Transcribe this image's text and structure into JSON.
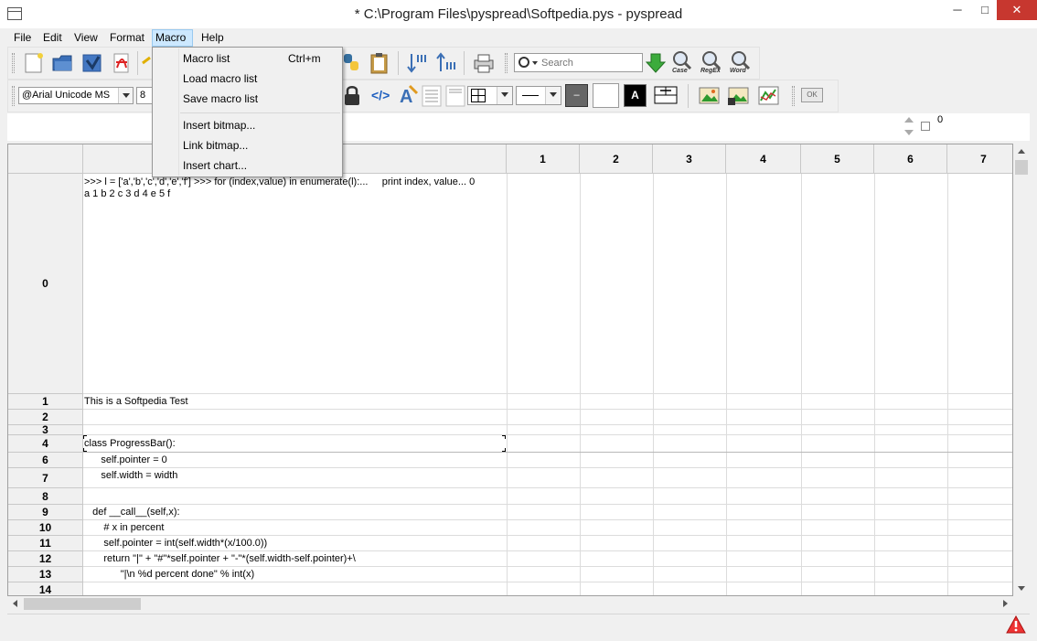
{
  "window": {
    "title": "* C:\\Program Files\\pyspread\\Softpedia.pys - pyspread",
    "min_glyph": "─",
    "max_glyph": "□",
    "close_glyph": "✕"
  },
  "menubar": {
    "items": [
      "File",
      "Edit",
      "View",
      "Format",
      "Macro",
      "Help"
    ],
    "active": "Macro"
  },
  "macro_menu": {
    "items": [
      {
        "label": "Macro list",
        "shortcut": "Ctrl+m"
      },
      {
        "label": "Load macro list",
        "shortcut": ""
      },
      {
        "label": "Save macro list",
        "shortcut": ""
      },
      {
        "label": "Insert bitmap...",
        "shortcut": ""
      },
      {
        "label": "Link bitmap...",
        "shortcut": ""
      },
      {
        "label": "Insert chart...",
        "shortcut": ""
      }
    ]
  },
  "toolbar": {
    "search_placeholder": "Search",
    "search_option_labels": [
      "Case",
      "RegEx",
      "Word"
    ],
    "ok_label": "OK",
    "table_number_label": "0"
  },
  "format_toolbar": {
    "font": "@Arial Unicode MS",
    "font_size": "8",
    "code_label": "</>",
    "bg_button_label": "–",
    "text_color_label": "A",
    "accent_blue": "#1e5fbf",
    "accent_green": "#2e9a2e"
  },
  "grid": {
    "columns": [
      "",
      "1",
      "2",
      "3",
      "4",
      "5",
      "6",
      "7"
    ],
    "rows": [
      {
        "label": "0",
        "text": ">>> l = ['a','b','c','d','e','f'] >>> for (index,value) in enumerate(l):...     print index, value... 0\na 1 b 2 c 3 d 4 e 5 f"
      },
      {
        "label": "1",
        "text": "This is a Softpedia Test"
      },
      {
        "label": "2",
        "text": ""
      },
      {
        "label": "3",
        "text": ""
      },
      {
        "label": "4",
        "text": "class ProgressBar():"
      },
      {
        "label": "6",
        "text": "      self.pointer = 0"
      },
      {
        "label": "7",
        "text": "      self.width = width"
      },
      {
        "label": "8",
        "text": ""
      },
      {
        "label": "9",
        "text": "   def __call__(self,x):"
      },
      {
        "label": "10",
        "text": "       # x in percent"
      },
      {
        "label": "11",
        "text": "       self.pointer = int(self.width*(x/100.0))"
      },
      {
        "label": "12",
        "text": "       return \"|\" + \"#\"*self.pointer + \"-\"*(self.width-self.pointer)+\\"
      },
      {
        "label": "13",
        "text": "             \"|\\n %d percent done\" % int(x)"
      },
      {
        "label": "14",
        "text": ""
      }
    ]
  }
}
